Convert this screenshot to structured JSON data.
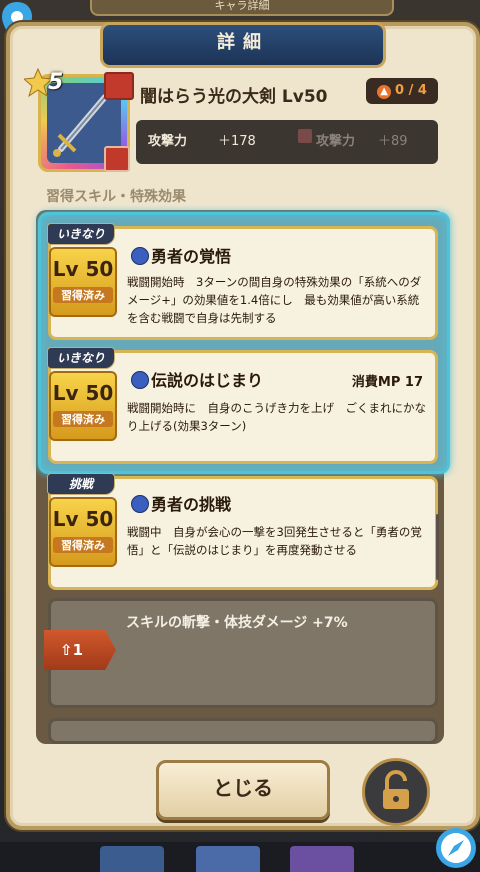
{
  "window": {
    "top_ribbon": "キャラ詳細"
  },
  "panel": {
    "title": "詳細"
  },
  "item": {
    "rarity_stars": "5",
    "name": "闇はらう光の大剣 Lv50",
    "upgrade": "0 / 4",
    "stats": [
      {
        "label": "攻撃力",
        "value": "＋178"
      },
      {
        "label": "攻撃力",
        "value": "＋89"
      }
    ]
  },
  "section_title": "習得スキル・特殊効果",
  "skills": [
    {
      "tag": "いきなり",
      "lv": "Lv 50",
      "status": "習得済み",
      "name": "勇者の覚悟",
      "mp": "",
      "desc": "戦闘開始時　3ターンの間自身の特殊効果の「系統へのダメージ+」の効果値を1.4倍にし　最も効果値が高い系統を含む戦闘で自身は先制する"
    },
    {
      "tag": "いきなり",
      "lv": "Lv 50",
      "status": "習得済み",
      "name": "伝説のはじまり",
      "mp": "消費MP 17",
      "desc": "戦闘開始時に　自身のこうげき力を上げ　ごくまれにかなり上げる(効果3ターン)"
    },
    {
      "tag": "挑戦",
      "lv": "Lv 50",
      "status": "習得済み",
      "name": "勇者の挑戦",
      "mp": "",
      "desc": "戦闘中　自身が会心の一撃を3回発生させると「勇者の覚悟」と「伝説のはじまり」を再度発動させる"
    }
  ],
  "locked_effect": {
    "unlock": "1",
    "text": "スキルの斬撃・体技ダメージ +7%"
  },
  "buttons": {
    "close": "とじる"
  },
  "colors": {
    "accent": "#4ec3d9",
    "gold": "#d7b555",
    "title_plate": "#2d4f7c"
  }
}
